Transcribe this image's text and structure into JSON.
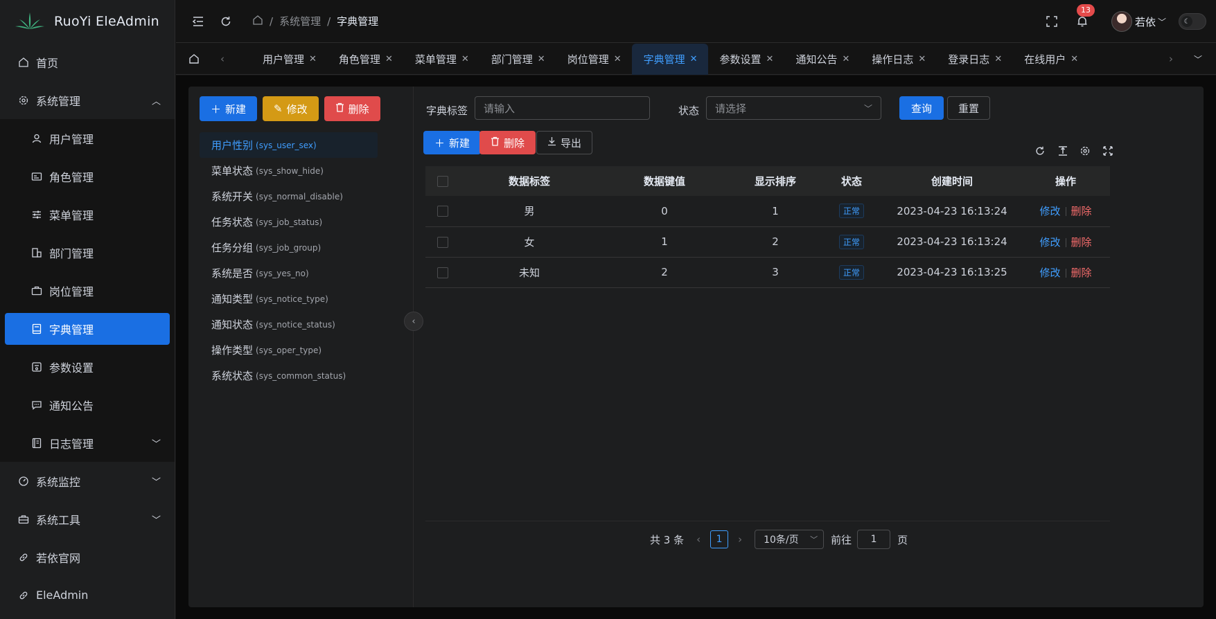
{
  "app": {
    "title": "RuoYi EleAdmin"
  },
  "sidebar": {
    "home": "首页",
    "system": {
      "label": "系统管理",
      "items": [
        {
          "label": "用户管理",
          "icon": "user-icon"
        },
        {
          "label": "角色管理",
          "icon": "id-card-icon"
        },
        {
          "label": "菜单管理",
          "icon": "sliders-icon"
        },
        {
          "label": "部门管理",
          "icon": "building-icon"
        },
        {
          "label": "岗位管理",
          "icon": "briefcase-icon"
        },
        {
          "label": "字典管理",
          "icon": "book-icon",
          "active": true
        },
        {
          "label": "参数设置",
          "icon": "settings-card-icon"
        },
        {
          "label": "通知公告",
          "icon": "message-icon"
        },
        {
          "label": "日志管理",
          "icon": "log-icon"
        }
      ]
    },
    "monitor": "系统监控",
    "tools": "系统工具",
    "site": "若依官网",
    "eleadmin": "EleAdmin"
  },
  "header": {
    "breadcrumb": [
      "系统管理",
      "字典管理"
    ],
    "notification_count": "13",
    "username": "若依"
  },
  "tabs": [
    "用户管理",
    "角色管理",
    "菜单管理",
    "部门管理",
    "岗位管理",
    "字典管理",
    "参数设置",
    "通知公告",
    "操作日志",
    "登录日志",
    "在线用户"
  ],
  "active_tab": "字典管理",
  "left_panel": {
    "buttons": {
      "add": "新建",
      "edit": "修改",
      "delete": "删除"
    },
    "dict_types": [
      {
        "name": "用户性别",
        "code": "(sys_user_sex)"
      },
      {
        "name": "菜单状态",
        "code": "(sys_show_hide)"
      },
      {
        "name": "系统开关",
        "code": "(sys_normal_disable)"
      },
      {
        "name": "任务状态",
        "code": "(sys_job_status)"
      },
      {
        "name": "任务分组",
        "code": "(sys_job_group)"
      },
      {
        "name": "系统是否",
        "code": "(sys_yes_no)"
      },
      {
        "name": "通知类型",
        "code": "(sys_notice_type)"
      },
      {
        "name": "通知状态",
        "code": "(sys_notice_status)"
      },
      {
        "name": "操作类型",
        "code": "(sys_oper_type)"
      },
      {
        "name": "系统状态",
        "code": "(sys_common_status)"
      }
    ]
  },
  "search": {
    "label_field": "字典标签",
    "label_placeholder": "请输入",
    "status_field": "状态",
    "status_placeholder": "请选择",
    "query": "查询",
    "reset": "重置"
  },
  "toolbar": {
    "add": "新建",
    "delete": "删除",
    "export": "导出"
  },
  "table": {
    "columns": [
      "数据标签",
      "数据键值",
      "显示排序",
      "状态",
      "创建时间",
      "操作"
    ],
    "rows": [
      {
        "label": "男",
        "value": "0",
        "sort": "1",
        "status": "正常",
        "created": "2023-04-23 16:13:24",
        "edit": "修改",
        "del": "删除"
      },
      {
        "label": "女",
        "value": "1",
        "sort": "2",
        "status": "正常",
        "created": "2023-04-23 16:13:24",
        "edit": "修改",
        "del": "删除"
      },
      {
        "label": "未知",
        "value": "2",
        "sort": "3",
        "status": "正常",
        "created": "2023-04-23 16:13:25",
        "edit": "修改",
        "del": "删除"
      }
    ]
  },
  "pagination": {
    "total": "共 3 条",
    "page": "1",
    "page_size": "10条/页",
    "goto_label": "前往",
    "goto_value": "1",
    "page_unit": "页"
  },
  "colors": {
    "primary": "#1a6fe3",
    "warning": "#d49a15",
    "danger": "#e04b4b",
    "link": "#409eff"
  }
}
